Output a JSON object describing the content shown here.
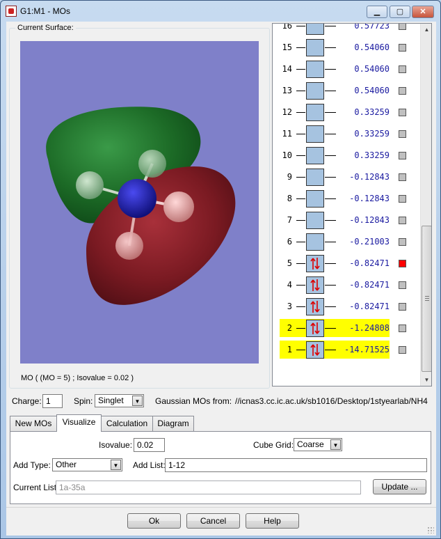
{
  "window": {
    "title": "G1:M1 - MOs"
  },
  "surface": {
    "caption": "Current Surface:",
    "status": "MO ( (MO = 5) ; Isovalue = 0.02 )"
  },
  "mo_list": [
    {
      "num": "16",
      "energy": "0.57723",
      "occupied": false,
      "highlight": false,
      "selected": false
    },
    {
      "num": "15",
      "energy": "0.54060",
      "occupied": false,
      "highlight": false,
      "selected": false
    },
    {
      "num": "14",
      "energy": "0.54060",
      "occupied": false,
      "highlight": false,
      "selected": false
    },
    {
      "num": "13",
      "energy": "0.54060",
      "occupied": false,
      "highlight": false,
      "selected": false
    },
    {
      "num": "12",
      "energy": "0.33259",
      "occupied": false,
      "highlight": false,
      "selected": false
    },
    {
      "num": "11",
      "energy": "0.33259",
      "occupied": false,
      "highlight": false,
      "selected": false
    },
    {
      "num": "10",
      "energy": "0.33259",
      "occupied": false,
      "highlight": false,
      "selected": false
    },
    {
      "num": "9",
      "energy": "-0.12843",
      "occupied": false,
      "highlight": false,
      "selected": false
    },
    {
      "num": "8",
      "energy": "-0.12843",
      "occupied": false,
      "highlight": false,
      "selected": false
    },
    {
      "num": "7",
      "energy": "-0.12843",
      "occupied": false,
      "highlight": false,
      "selected": false
    },
    {
      "num": "6",
      "energy": "-0.21003",
      "occupied": false,
      "highlight": false,
      "selected": false
    },
    {
      "num": "5",
      "energy": "-0.82471",
      "occupied": true,
      "highlight": false,
      "selected": true
    },
    {
      "num": "4",
      "energy": "-0.82471",
      "occupied": true,
      "highlight": false,
      "selected": false
    },
    {
      "num": "3",
      "energy": "-0.82471",
      "occupied": true,
      "highlight": false,
      "selected": false
    },
    {
      "num": "2",
      "energy": "-1.24808",
      "occupied": true,
      "highlight": true,
      "selected": false
    },
    {
      "num": "1",
      "energy": "-14.71525",
      "occupied": true,
      "highlight": true,
      "selected": false
    }
  ],
  "settings": {
    "charge_label": "Charge:",
    "charge_value": "1",
    "spin_label": "Spin:",
    "spin_value": "Singlet",
    "source_label": "Gaussian MOs from:",
    "source_path": "//icnas3.cc.ic.ac.uk/sb1016/Desktop/1styearlab/NH4"
  },
  "tabs": [
    "New MOs",
    "Visualize",
    "Calculation",
    "Diagram"
  ],
  "visualize": {
    "isovalue_label": "Isovalue:",
    "isovalue": "0.02",
    "cube_grid_label": "Cube Grid:",
    "cube_grid": "Coarse",
    "add_type_label": "Add Type:",
    "add_type": "Other",
    "add_list_label": "Add List:",
    "add_list": "1-12",
    "current_list_label": "Current List:",
    "current_list": "1a-35a",
    "update_label": "Update ..."
  },
  "buttons": {
    "ok": "Ok",
    "cancel": "Cancel",
    "help": "Help"
  },
  "colors": {
    "positive_lobe": "#1f7a28",
    "negative_lobe": "#8a1e24",
    "background": "#7f80c9",
    "highlight": "#ffff00",
    "selected": "#ff0000"
  }
}
